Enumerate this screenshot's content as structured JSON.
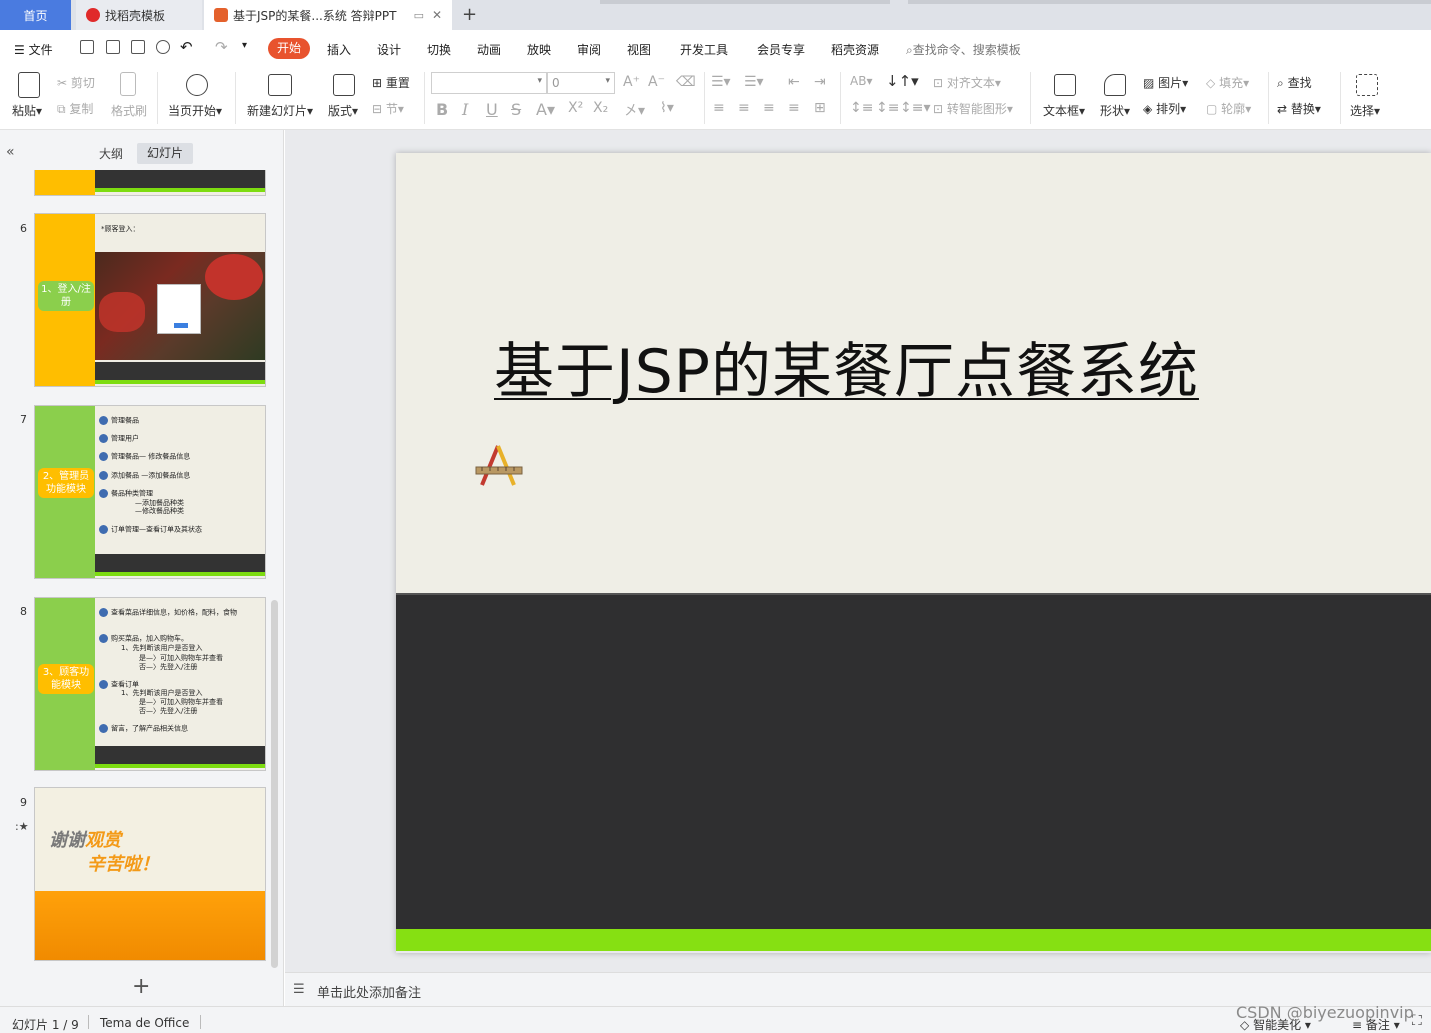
{
  "tabs": {
    "home": "首页",
    "templates": "找稻壳模板",
    "document": "基于JSP的某餐...系统 答辩PPT"
  },
  "menu": {
    "file": "文件",
    "items": [
      "开始",
      "插入",
      "设计",
      "切换",
      "动画",
      "放映",
      "审阅",
      "视图",
      "开发工具",
      "会员专享",
      "稻壳资源"
    ],
    "search_placeholder": "查找命令、搜索模板"
  },
  "ribbon": {
    "paste": "粘贴",
    "cut": "剪切",
    "copy": "复制",
    "format_painter": "格式刷",
    "from_current": "当页开始",
    "new_slide": "新建幻灯片",
    "layout": "版式",
    "section": "节",
    "reset": "重置",
    "font_size_value": "0",
    "align_text": "对齐文本",
    "smart_art": "转智能图形",
    "text_box": "文本框",
    "shape": "形状",
    "picture": "图片",
    "arrange": "排列",
    "fill": "填充",
    "outline": "轮廓",
    "find": "查找",
    "replace": "替换",
    "select": "选择"
  },
  "panel": {
    "tab_outline": "大纲",
    "tab_slides": "幻灯片",
    "slides": [
      {
        "num": "6",
        "button": "1、登入/注册",
        "caption": "*顾客登入："
      },
      {
        "num": "7",
        "button": "2、管理员功能模块",
        "bullets": [
          "管理餐品",
          "管理用户",
          "管理餐品— 修改餐品信息",
          "添加餐品 —添加餐品信息",
          "餐品种类管理",
          "—添加餐品种类",
          "—修改餐品种类",
          "订单管理—查看订单及其状态"
        ]
      },
      {
        "num": "8",
        "button": "3、顾客功能模块",
        "bullets": [
          "查看菜品详细信息，如价格，配料，食物",
          "购买菜品，加入购物车。",
          "1、先判断该用户是否登入",
          "是—〉可加入购物车并查看",
          "否—〉先登入/注册",
          "查看订单",
          "1、先判断该用户是否登入",
          "是—〉可加入购物车并查看",
          "否—〉先登入/注册",
          "留言，了解产品相关信息"
        ]
      },
      {
        "num": "9",
        "line1a": "谢谢",
        "line1b": "观赏",
        "line2": "辛苦啦！"
      }
    ]
  },
  "slide": {
    "title": "基于JSP的某餐厅点餐系统"
  },
  "notes": {
    "placeholder": "单击此处添加备注"
  },
  "status": {
    "slide_counter": "幻灯片 1 / 9",
    "theme": "Tema de Office",
    "beautify": "智能美化",
    "notes": "备注"
  },
  "watermark": "CSDN @biyezuopinvip",
  "colors": {
    "accent": "#e8532e",
    "tab_active": "#4a7be0",
    "slide_green": "#86e012",
    "slide_dark": "#2f2f30",
    "thumb_orange": "#ffbe00",
    "thumb_green": "#8bcf4c"
  }
}
